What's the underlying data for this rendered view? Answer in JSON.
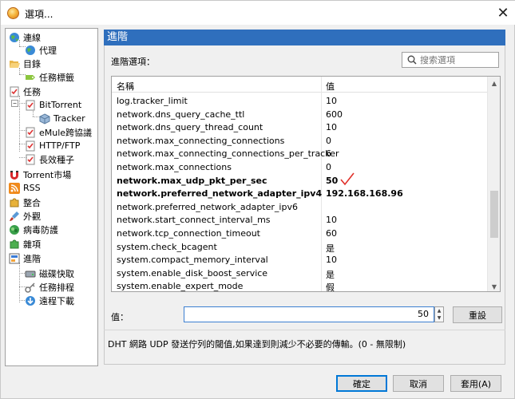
{
  "window": {
    "title": "選項..."
  },
  "sidebar": {
    "items": [
      {
        "label": "連線",
        "icon": "globe-icon"
      },
      {
        "label": "代理",
        "icon": "globe-small-icon"
      },
      {
        "label": "目錄",
        "icon": "folder-open-icon"
      },
      {
        "label": "任務標籤",
        "icon": "tag-icon"
      },
      {
        "label": "任務",
        "icon": "task-list-icon"
      },
      {
        "label": "BitTorrent",
        "icon": "task-list-icon"
      },
      {
        "label": "Tracker",
        "icon": "cube-icon"
      },
      {
        "label": "eMule跨協議",
        "icon": "task-list-icon"
      },
      {
        "label": "HTTP/FTP",
        "icon": "task-list-icon"
      },
      {
        "label": "長效種子",
        "icon": "task-list-icon"
      },
      {
        "label": "Torrent市場",
        "icon": "magnet-icon"
      },
      {
        "label": "RSS",
        "icon": "rss-icon"
      },
      {
        "label": "整合",
        "icon": "puzzle-icon"
      },
      {
        "label": "外觀",
        "icon": "brush-icon"
      },
      {
        "label": "病毒防護",
        "icon": "shield-icon"
      },
      {
        "label": "雜項",
        "icon": "puzzle-green-icon"
      },
      {
        "label": "進階",
        "icon": "settings-panel-icon"
      },
      {
        "label": "磁碟快取",
        "icon": "disk-icon"
      },
      {
        "label": "任務排程",
        "icon": "key-icon"
      },
      {
        "label": "遠程下載",
        "icon": "globe-arrow-icon"
      }
    ]
  },
  "main": {
    "header": "進階",
    "advanced_label": "進階選項：",
    "search_placeholder": "搜索選項",
    "table": {
      "col_name": "名稱",
      "col_value": "值",
      "rows": [
        {
          "name": "log.tracker_limit",
          "value": "10",
          "bold": false
        },
        {
          "name": "network.dns_query_cache_ttl",
          "value": "600",
          "bold": false
        },
        {
          "name": "network.dns_query_thread_count",
          "value": "10",
          "bold": false
        },
        {
          "name": "network.max_connecting_connections",
          "value": "0",
          "bold": false
        },
        {
          "name": "network.max_connecting_connections_per_tracker",
          "value": "6",
          "bold": false
        },
        {
          "name": "network.max_connections",
          "value": "0",
          "bold": false
        },
        {
          "name": "network.max_udp_pkt_per_sec",
          "value": "50",
          "bold": true
        },
        {
          "name": "network.preferred_network_adapter_ipv4",
          "value": "192.168.168.96",
          "bold": true
        },
        {
          "name": "network.preferred_network_adapter_ipv6",
          "value": "",
          "bold": false
        },
        {
          "name": "network.start_connect_interval_ms",
          "value": "10",
          "bold": false
        },
        {
          "name": "network.tcp_connection_timeout",
          "value": "60",
          "bold": false
        },
        {
          "name": "system.check_bcagent",
          "value": "是",
          "bold": false
        },
        {
          "name": "system.compact_memory_interval",
          "value": "10",
          "bold": false
        },
        {
          "name": "system.enable_disk_boost_service",
          "value": "是",
          "bold": false
        },
        {
          "name": "system.enable_expert_mode",
          "value": "假",
          "bold": false
        }
      ]
    },
    "value_label": "值：",
    "value": "50",
    "reset_label": "重設",
    "description": "DHT 網路 UDP 發送佇列的閾值,如果達到則減少不必要的傳輸。(0 - 無限制)"
  },
  "buttons": {
    "ok": "確定",
    "cancel": "取消",
    "apply": "套用(A)"
  },
  "colors": {
    "header_bg": "#2f6fbd",
    "checkmark": "#e0302a"
  }
}
